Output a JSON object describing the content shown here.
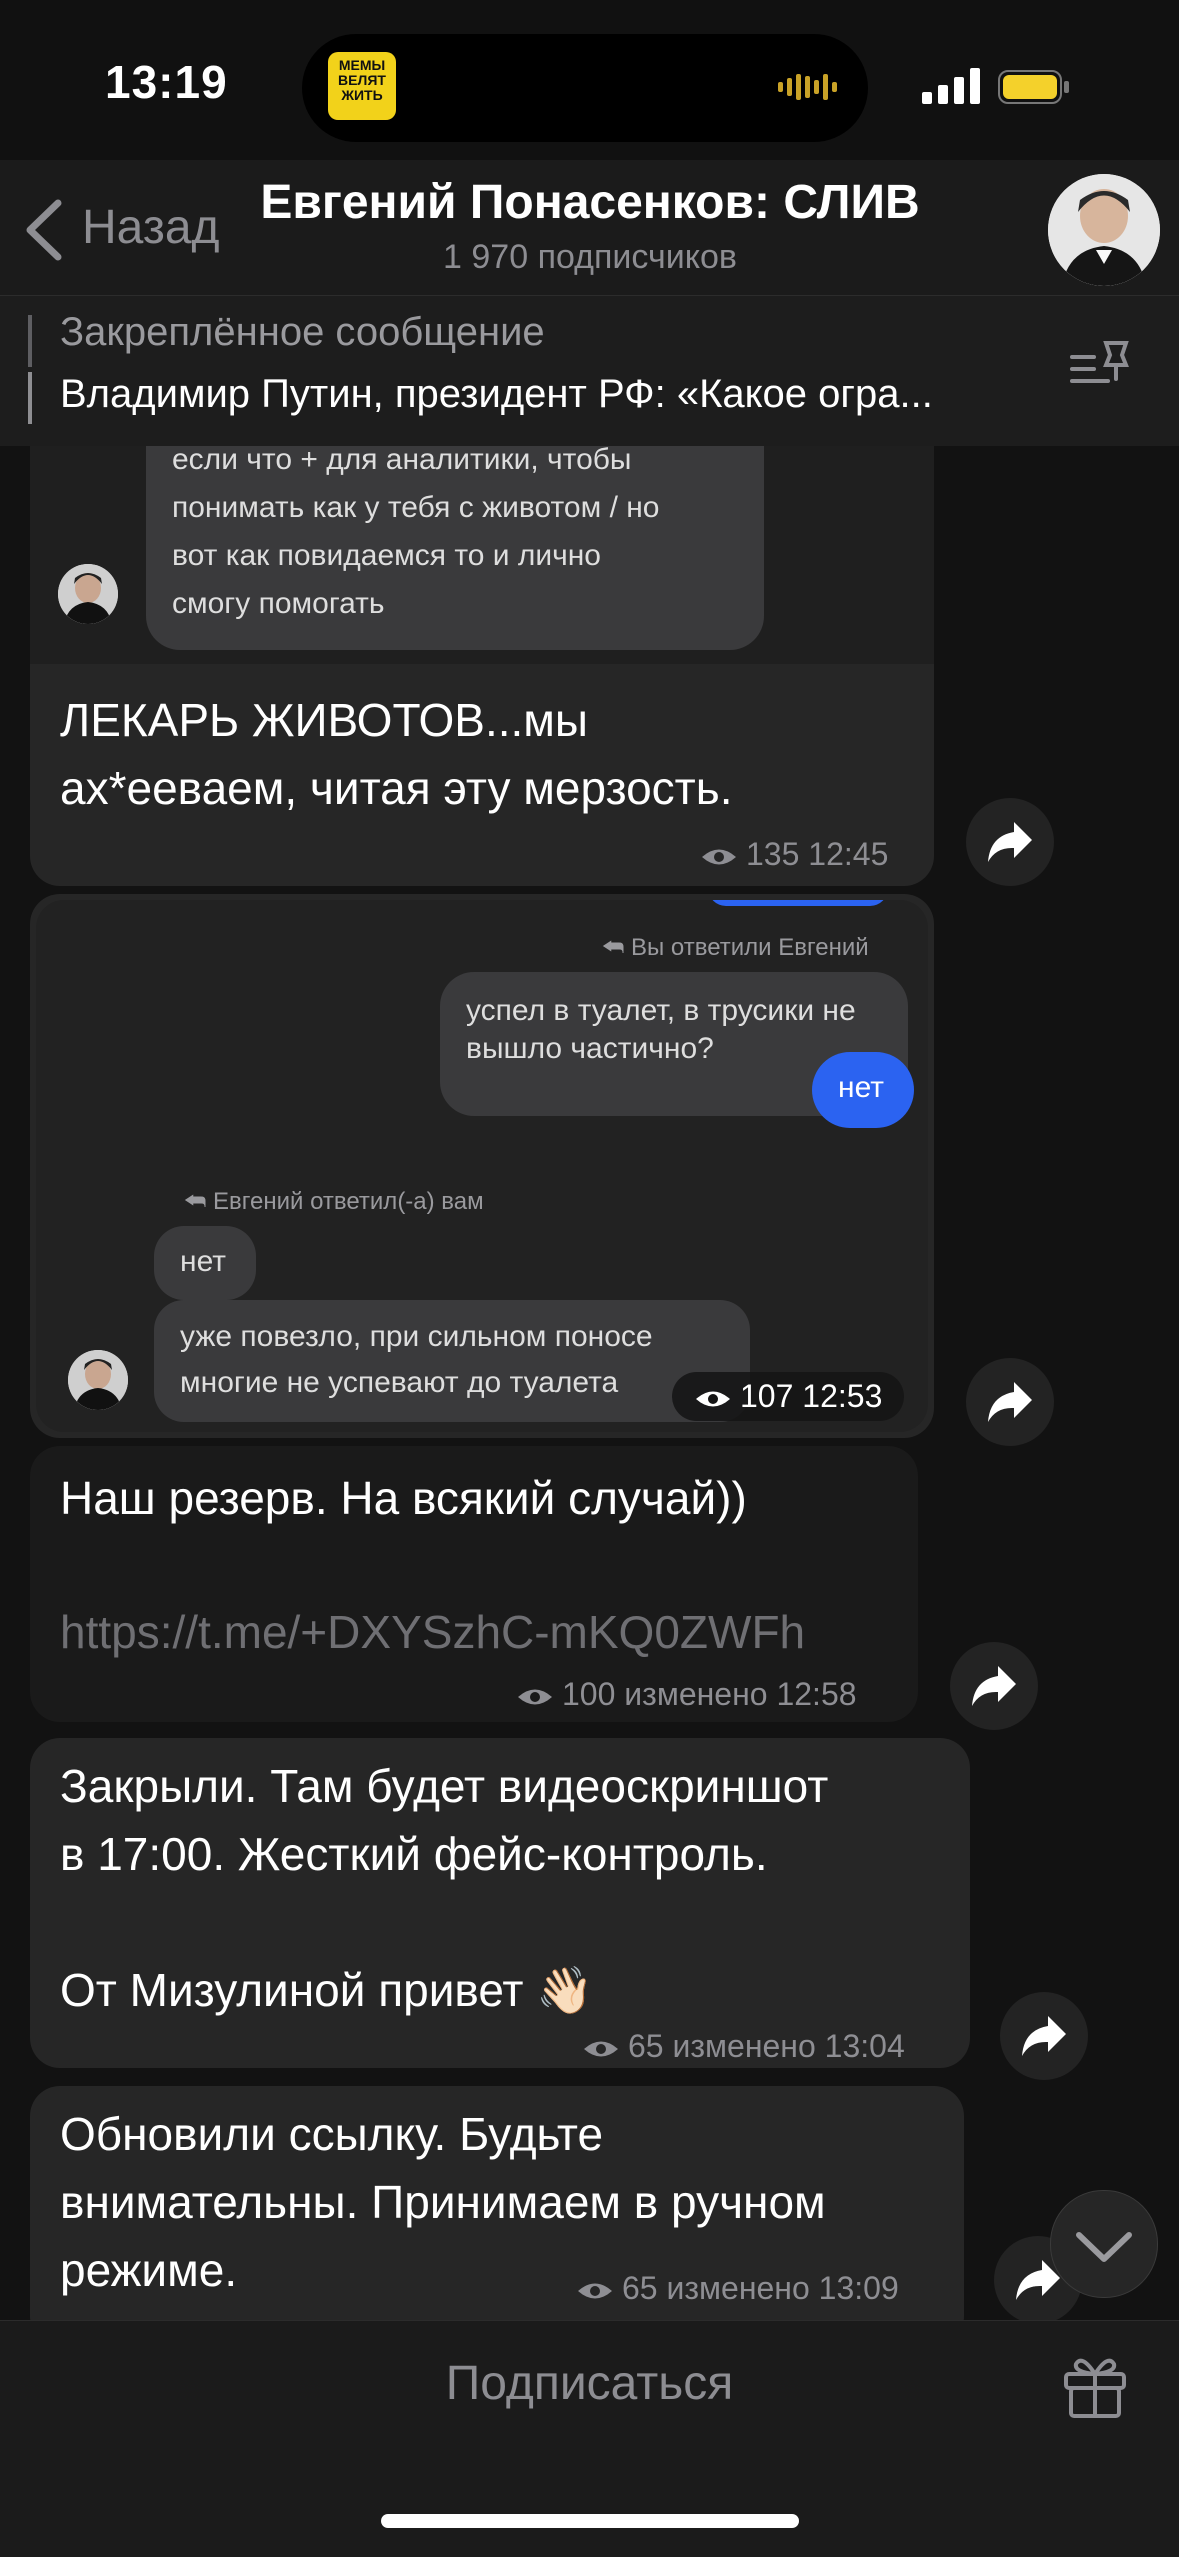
{
  "status_bar": {
    "time": "13:19",
    "island_thumb_text": "МЕМЫ ВЕЛЯТ ЖИТЬ"
  },
  "header": {
    "back_label": "Назад",
    "title": "Евгений Понасенков: СЛИВ",
    "subtitle": "1 970 подписчиков"
  },
  "pinned": {
    "label": "Закреплённое сообщение",
    "text": "Владимир Путин, президент РФ: «Какое огра..."
  },
  "messages": [
    {
      "screenshot_lines": [
        "если что + для аналитики, чтобы",
        "понимать как у тебя с животом / но",
        "вот как повидаемся то и лично",
        "смогу помогать"
      ],
      "text_line1": "ЛЕКАРЬ ЖИВОТОВ...мы",
      "text_line2": "ах*ееваем, читая эту мерзость.",
      "views": "135",
      "time": "12:45"
    },
    {
      "reply_you": "Вы ответили Евгений",
      "quote_line1": "успел в туалет, в трусики не",
      "quote_line2": "вышло частично?",
      "answer": "нет",
      "reply_him": "Евгений ответил(-а) вам",
      "him_1": "нет",
      "him_2_line1": "уже повезло, при сильном поносе",
      "him_2_line2": "многие не успевают до туалета",
      "views": "107",
      "time": "12:53"
    },
    {
      "text": "Наш резерв. На всякий случай))",
      "link": "https://t.me/+DXYSzhC-mKQ0ZWFh",
      "views": "100",
      "edited": "изменено",
      "time": "12:58"
    },
    {
      "line1": "Закрыли. Там будет видеоскриншот",
      "line2": "в 17:00. Жесткий фейс-контроль.",
      "line3": "От Мизулиной привет 👋🏻",
      "views": "65",
      "edited": "изменено",
      "time": "13:04"
    },
    {
      "line1": "Обновили ссылку. Будьте",
      "line2": "внимательны. Принимаем в ручном",
      "line3": "режиме.",
      "views": "65",
      "edited": "изменено",
      "time": "13:09"
    }
  ],
  "bottom": {
    "subscribe": "Подписаться"
  },
  "colors": {
    "background": "#121212",
    "bubble": "#262626",
    "blue_bubble": "#2b63f1",
    "muted": "#8e8e93"
  }
}
